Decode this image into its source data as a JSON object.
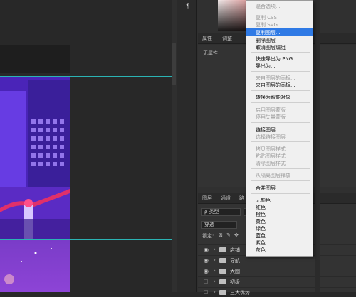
{
  "properties_panel": {
    "tabs": [
      "属性",
      "调整"
    ],
    "empty_text": "无属性"
  },
  "layers_panel": {
    "tabs": [
      "图层",
      "通道",
      "路"
    ],
    "kind_filter": "ρ 类型",
    "blend_mode": "穿透",
    "lock_label": "锁定:",
    "layers": [
      {
        "name": "店铺",
        "visible": true
      },
      {
        "name": "导航",
        "visible": true
      },
      {
        "name": "大图",
        "visible": true
      },
      {
        "name": "初级",
        "visible": false
      },
      {
        "name": "三大优势",
        "visible": false
      }
    ]
  },
  "context_menu": {
    "items": [
      {
        "label": "混合选项...",
        "disabled": true
      },
      {
        "label": "复制 CSS",
        "disabled": true
      },
      {
        "label": "复制 SVG",
        "disabled": true
      },
      {
        "label": "复制图层...",
        "disabled": false,
        "highlighted": true
      },
      {
        "label": "删除图层",
        "disabled": false
      },
      {
        "label": "取消图层编组",
        "disabled": false
      },
      {
        "label": "快速导出为 PNG",
        "disabled": false
      },
      {
        "label": "导出为...",
        "disabled": false
      },
      {
        "label": "来自图层的画板...",
        "disabled": true
      },
      {
        "label": "来自图层的画板...",
        "disabled": false
      },
      {
        "label": "转换为智能对象",
        "disabled": false
      },
      {
        "label": "启用图层蒙版",
        "disabled": true
      },
      {
        "label": "停用矢量蒙版",
        "disabled": true
      },
      {
        "label": "链接图层",
        "disabled": false
      },
      {
        "label": "选择链接图层",
        "disabled": true
      },
      {
        "label": "拷贝图层样式",
        "disabled": true
      },
      {
        "label": "粘贴图层样式",
        "disabled": true
      },
      {
        "label": "清除图层样式",
        "disabled": true
      },
      {
        "label": "从隔离图层释放",
        "disabled": true
      },
      {
        "label": "合并图层",
        "disabled": false
      },
      {
        "label": "无颜色",
        "disabled": false
      },
      {
        "label": "红色",
        "disabled": false
      },
      {
        "label": "橙色",
        "disabled": false
      },
      {
        "label": "黄色",
        "disabled": false
      },
      {
        "label": "绿色",
        "disabled": false
      },
      {
        "label": "蓝色",
        "disabled": false
      },
      {
        "label": "紫色",
        "disabled": false
      },
      {
        "label": "灰色",
        "disabled": false
      }
    ]
  },
  "colors": {
    "highlight": "#2f7ae5",
    "guide": "#2bb3b3",
    "panel_bg": "#303030"
  },
  "icons": {
    "paragraph": "¶",
    "eye": "👁",
    "chevron": "›"
  }
}
